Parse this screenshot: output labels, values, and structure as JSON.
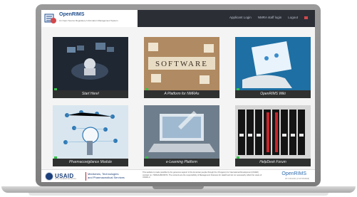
{
  "header": {
    "app_name": "OpenRIMS",
    "app_subtitle": "An Open Source Regulatory Information Management System",
    "nav": [
      "Applicant Login",
      "NMRA staff login",
      "Logout"
    ]
  },
  "tiles": [
    {
      "label": "Start Here!"
    },
    {
      "label": "A Platform for NMRAs",
      "image_text": "SOFTWARE"
    },
    {
      "label": "OpenRIMS Wiki"
    },
    {
      "label": "Pharmacovigilance Module"
    },
    {
      "label": "e-Learning Platform"
    },
    {
      "label": "HelpDesk Forum"
    }
  ],
  "footer": {
    "usaid": "USAID",
    "usaid_sub": "FROM THE AMERICAN PEOPLE",
    "mtaps_line1": "Medicines, Technologies",
    "mtaps_line2": "and Pharmaceutical Services",
    "disclaimer": "This website is made possible by the generous support of the American people through the US Agency for International Development (USAID) contract no. 7200AA18C00074. The contents are the responsibility of Management Sciences for Health and do not necessarily reflect the views of USAID or",
    "logo": "OpenRIMS",
    "version": "RT-V.08.2021 (V-1073543628)"
  },
  "colors": {
    "header_bg": "#2b2e35",
    "brand_blue": "#1f4e8c",
    "status_green": "#36c34a",
    "usaid_red": "#b22234"
  }
}
